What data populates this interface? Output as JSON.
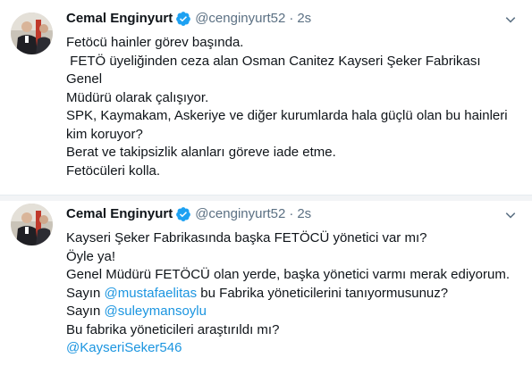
{
  "tweets": [
    {
      "author_name": "Cemal Enginyurt",
      "handle": "@cenginyurt52",
      "separator": "·",
      "time": "2s",
      "verified_badge": "verified-checkmark-icon",
      "lines": [
        "Fetöcü hainler görev başında.",
        " FETÖ üyeliğinden ceza alan Osman Canitez Kayseri Şeker Fabrikası Genel",
        "Müdürü olarak çalışıyor.",
        "SPK, Kaymakam, Askeriye ve diğer kurumlarda hala güçlü olan bu hainleri",
        "kim koruyor?",
        "Berat ve takipsizlik alanları göreve iade etme.",
        "Fetöcüleri kolla."
      ]
    },
    {
      "author_name": "Cemal Enginyurt",
      "handle": "@cenginyurt52",
      "separator": "·",
      "time": "2s",
      "verified_badge": "verified-checkmark-icon",
      "lines": [
        "Kayseri Şeker Fabrikasında başka FETÖCÜ yönetici var mı?",
        "Öyle ya!",
        "Genel Müdürü FETÖCÜ olan yerde, başka yönetici varmı merak ediyorum."
      ],
      "line4": {
        "prefix": "Sayın ",
        "mention": "@mustafaelitas",
        "suffix": " bu Fabrika yöneticilerini tanıyormusunuz?"
      },
      "line5": {
        "prefix": "Sayın ",
        "mention": "@suleymansoylu"
      },
      "line6": "Bu fabrika yöneticileri araştırıldı mı?",
      "line7_mention": "@KayseriSeker546"
    }
  ],
  "colors": {
    "text": "#0f1419",
    "secondary": "#5b7083",
    "link": "#1b95e0",
    "verified": "#1da1f2",
    "divider": "#f2f4f6"
  }
}
